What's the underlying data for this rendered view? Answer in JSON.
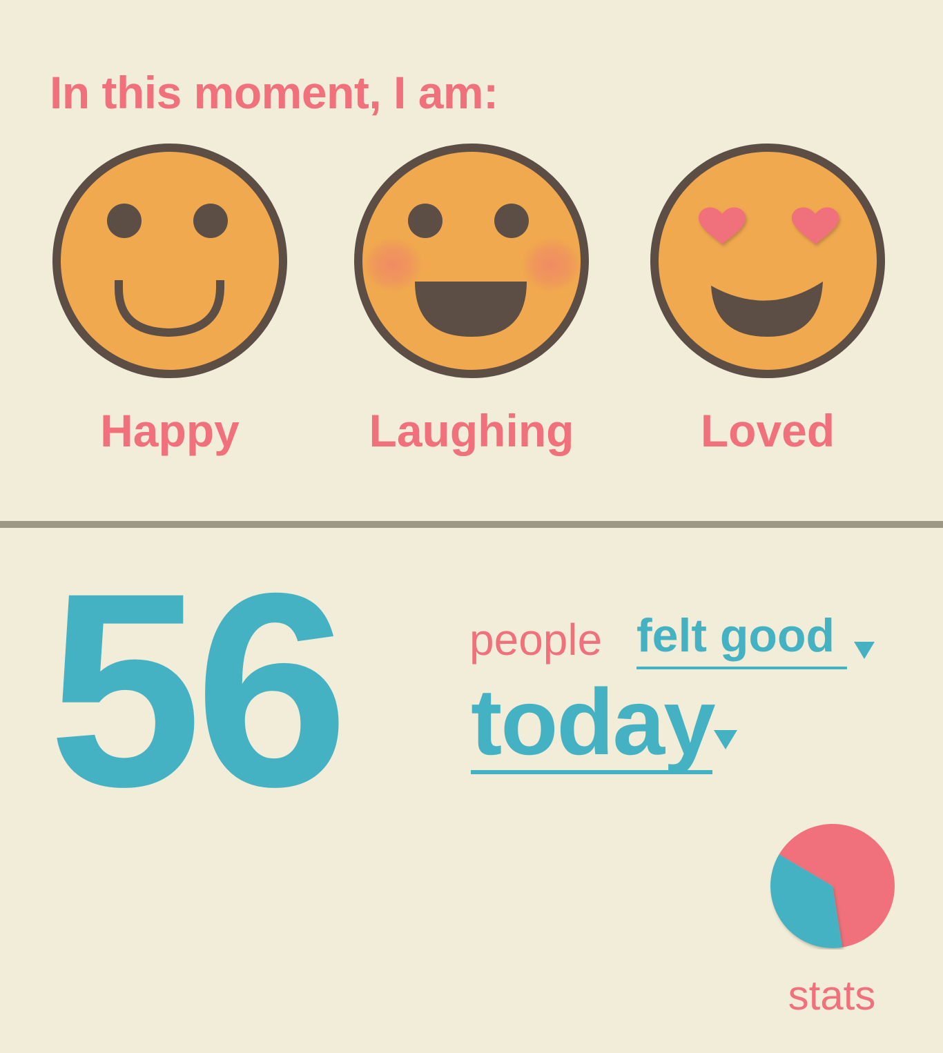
{
  "colors": {
    "background": "#f2edd9",
    "accent_pink": "#f0717c",
    "accent_teal": "#45b2c3",
    "face_fill": "#f0a94e",
    "face_outline": "#5c4d45",
    "divider": "#9d9886"
  },
  "prompt": {
    "text": "In this moment, I am:"
  },
  "moods": [
    {
      "label": "Happy",
      "icon": "smiley-face-icon"
    },
    {
      "label": "Laughing",
      "icon": "laughing-face-icon"
    },
    {
      "label": "Loved",
      "icon": "heart-eyes-face-icon"
    }
  ],
  "summary": {
    "count": "56",
    "people_word": "people",
    "feeling": {
      "value": "felt good",
      "icon": "dropdown-caret-icon"
    },
    "period": {
      "value": "today",
      "icon": "dropdown-caret-icon"
    }
  },
  "stats": {
    "label": "stats",
    "icon": "pie-chart-icon"
  },
  "chart_data": {
    "type": "pie",
    "values": [
      64,
      36
    ],
    "colors": [
      "#f0717c",
      "#45b2c3"
    ]
  }
}
